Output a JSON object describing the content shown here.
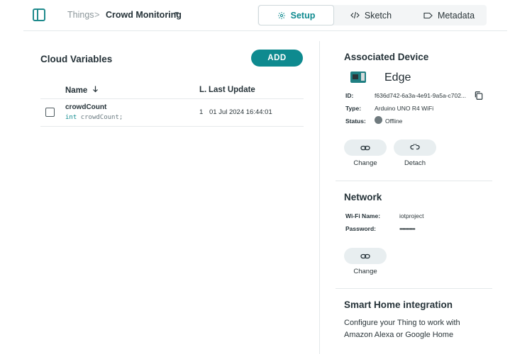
{
  "header": {
    "breadcrumb_root": "Things",
    "breadcrumb_separator": ">",
    "breadcrumb_current": "Crowd Monitoring",
    "tabs": [
      {
        "label": "Setup",
        "icon": "gear-icon",
        "active": true
      },
      {
        "label": "Sketch",
        "icon": "code-icon",
        "active": false
      },
      {
        "label": "Metadata",
        "icon": "tag-icon",
        "active": false
      }
    ]
  },
  "variables": {
    "title": "Cloud Variables",
    "add_label": "ADD",
    "columns": {
      "name": "Name",
      "last_value": "L.",
      "last_update": "Last Update"
    },
    "rows": [
      {
        "name": "crowdCount",
        "decl_type": "int",
        "decl_rest": "crowdCount;",
        "last_value": "1",
        "last_update": "01 Jul 2024 16:44:01"
      }
    ]
  },
  "device": {
    "title": "Associated Device",
    "name": "Edge",
    "id_label": "ID:",
    "id_value": "f636d742-6a3a-4e91-9a5a-c702...",
    "type_label": "Type:",
    "type_value": "Arduino UNO R4 WiFi",
    "status_label": "Status:",
    "status_value": "Offline",
    "change_label": "Change",
    "detach_label": "Detach"
  },
  "network": {
    "title": "Network",
    "wifi_label": "Wi-Fi Name:",
    "wifi_value": "iotproject",
    "password_label": "Password:",
    "password_value": "•••••••••••",
    "change_label": "Change"
  },
  "smart_home": {
    "title": "Smart Home integration",
    "description": "Configure your Thing to work with Amazon Alexa or Google Home"
  },
  "colors": {
    "accent": "#0e8a8f",
    "status_offline": "#6f7a7e"
  }
}
